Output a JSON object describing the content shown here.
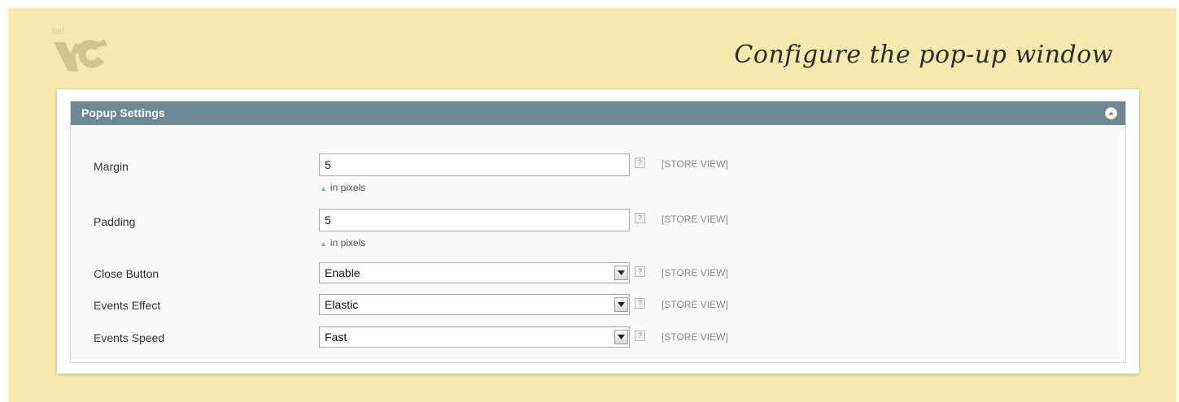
{
  "caption": "Configure the pop-up window",
  "logo": {
    "text": "bel",
    "icon": "belvg-logo-icon"
  },
  "section": {
    "title": "Popup Settings",
    "collapse_icon": "chevron-up-icon",
    "header_color": "#6f8992"
  },
  "fields": [
    {
      "label": "Margin",
      "value": "5",
      "note": "in pixels",
      "help": "?",
      "scope": "[STORE VIEW]"
    },
    {
      "label": "Padding",
      "value": "5",
      "note": "in pixels",
      "help": "?",
      "scope": "[STORE VIEW]"
    },
    {
      "label": "Close Button",
      "value": "Enable",
      "help": "?",
      "scope": "[STORE VIEW]"
    },
    {
      "label": "Events Effect",
      "value": "Elastic",
      "help": "?",
      "scope": "[STORE VIEW]"
    },
    {
      "label": "Events Speed",
      "value": "Fast",
      "help": "?",
      "scope": "[STORE VIEW]"
    }
  ],
  "colors": {
    "background": "#f5eaad",
    "accent": "#6f8992"
  }
}
